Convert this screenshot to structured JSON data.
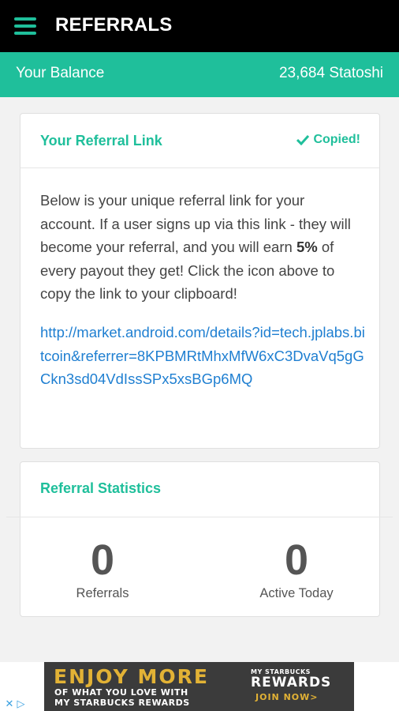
{
  "header": {
    "title": "REFERRALS",
    "menu_icon": "hamburger-icon"
  },
  "balance": {
    "label": "Your Balance",
    "value": "23,684 Statoshi"
  },
  "referral_link_card": {
    "title": "Your Referral Link",
    "copied_label": "Copied!",
    "copied_icon": "checkmark-icon",
    "text_before": "Below is your unique referral link for your account. If a user signs up via this link - they will become your referral, and you will earn ",
    "percent": "5%",
    "text_after": " of every payout they get! Click the icon above to copy the link to your clipboard!",
    "link": "http://market.android.com/details?id=tech.jplabs.bitcoin&referrer=8KPBMRtMhxMfW6xC3DvaVq5gGCkn3sd04VdIssSPx5xsBGp6MQ"
  },
  "stats_card": {
    "title": "Referral Statistics",
    "referrals": {
      "value": "0",
      "label": "Referrals"
    },
    "active_today": {
      "value": "0",
      "label": "Active Today"
    }
  },
  "ad": {
    "headline": "ENJOY MORE",
    "sub_line1": "OF WHAT YOU LOVE WITH",
    "sub_line2": "MY STARBUCKS REWARDS",
    "brand_small": "MY STARBUCKS",
    "brand_big": "REWARDS",
    "cta": "JOIN NOW>",
    "colors": {
      "gold": "#e2b235",
      "background": "#3b3b3b"
    }
  },
  "colors": {
    "accent": "#1fbf9b",
    "link": "#1f7fd1",
    "topbar": "#000000"
  }
}
